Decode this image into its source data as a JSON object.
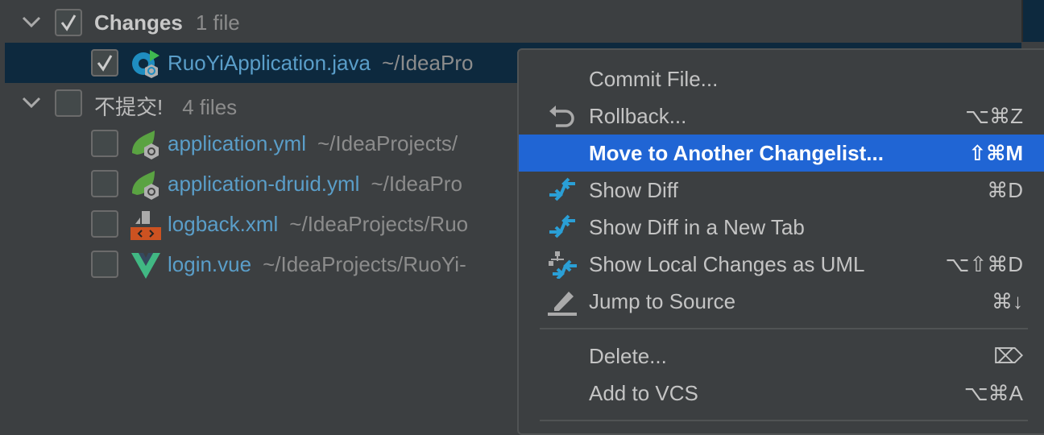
{
  "tree": {
    "groups": [
      {
        "name": "Changes",
        "count": "1 file",
        "checked": true,
        "files": [
          {
            "name": "RuoYiApplication.java",
            "path": "~/IdeaPro",
            "checked": true,
            "icon": "spring-boot-java-icon"
          }
        ]
      },
      {
        "name": "不提交!",
        "count": "4 files",
        "checked": false,
        "files": [
          {
            "name": "application.yml",
            "path": "~/IdeaProjects/",
            "icon": "spring-boot-config-icon"
          },
          {
            "name": "application-druid.yml",
            "path": "~/IdeaPro",
            "icon": "spring-boot-config-icon"
          },
          {
            "name": "logback.xml",
            "path": "~/IdeaProjects/Ruo",
            "icon": "xml-file-icon"
          },
          {
            "name": "login.vue",
            "path": "~/IdeaProjects/RuoYi-",
            "icon": "vue-icon"
          }
        ]
      }
    ]
  },
  "menu": {
    "items": [
      {
        "label": "Commit File...",
        "shortcut": ""
      },
      {
        "label": "Rollback...",
        "shortcut": "⌥⌘Z",
        "icon": "rollback-icon"
      },
      {
        "label": "Move to Another Changelist...",
        "shortcut": "⇧⌘M",
        "highlighted": true
      },
      {
        "label": "Show Diff",
        "shortcut": "⌘D",
        "icon": "diff-icon"
      },
      {
        "label": "Show Diff in a New Tab",
        "shortcut": "",
        "icon": "diff-icon"
      },
      {
        "label": "Show Local Changes as UML",
        "shortcut": "⌥⇧⌘D",
        "icon": "uml-diff-icon"
      },
      {
        "label": "Jump to Source",
        "shortcut": "⌘↓",
        "icon": "edit-icon"
      },
      {
        "label": "Delete...",
        "shortcut": "⌦"
      },
      {
        "label": "Add to VCS",
        "shortcut": "⌥⌘A"
      }
    ]
  },
  "colors": {
    "highlight": "#2065d4",
    "selected_row": "#0d293e",
    "file_link": "#5a9ec9"
  }
}
